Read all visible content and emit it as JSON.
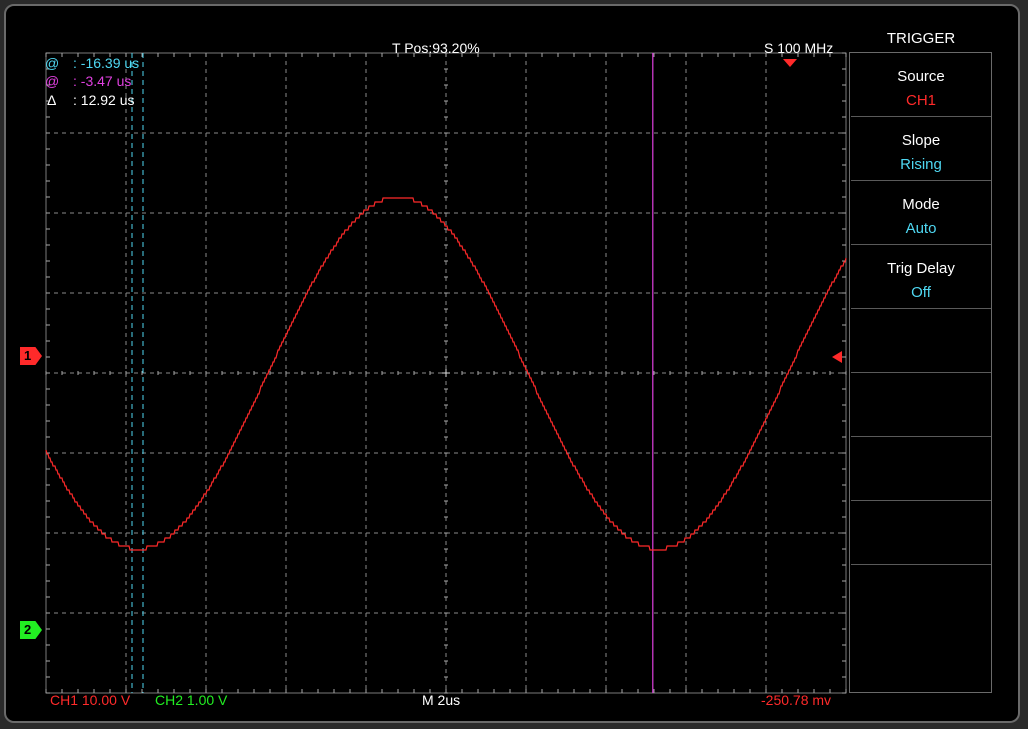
{
  "header": {
    "tpos": "T Pos:93.20%",
    "sample_rate": "S 100 MHz"
  },
  "cursors": {
    "c1_label": "@",
    "c1_value": ": -16.39 us",
    "c2_label": "@",
    "c2_value": ": -3.47 us",
    "delta_label": "Δ",
    "delta_value": ": 12.92 us"
  },
  "markers": {
    "ch1": "1",
    "ch2": "2"
  },
  "footer": {
    "ch1_scale": "CH1 10.00 V",
    "ch2_scale": "CH2 1.00 V",
    "timebase": "M 2us",
    "trigger_level": "-250.78 mv"
  },
  "menu": {
    "title": "TRIGGER",
    "items": [
      {
        "label": "Source",
        "value": "CH1"
      },
      {
        "label": "Slope",
        "value": "Rising"
      },
      {
        "label": "Mode",
        "value": "Auto"
      },
      {
        "label": "Trig Delay",
        "value": "Off"
      },
      {
        "label": "",
        "value": ""
      },
      {
        "label": "",
        "value": ""
      },
      {
        "label": "",
        "value": ""
      },
      {
        "label": "",
        "value": ""
      },
      {
        "label": "",
        "value": ""
      }
    ]
  },
  "colors": {
    "ch1": "#ff2a2a",
    "ch2": "#22ee22",
    "cursor1": "#4fd8f2",
    "cursor2": "#e040e0",
    "menu_value": "#4fd8f2",
    "grid": "#8a8a8a"
  },
  "waveform": {
    "channel": "CH1",
    "period_us": 13.0,
    "amplitude_div": 2.2
  }
}
